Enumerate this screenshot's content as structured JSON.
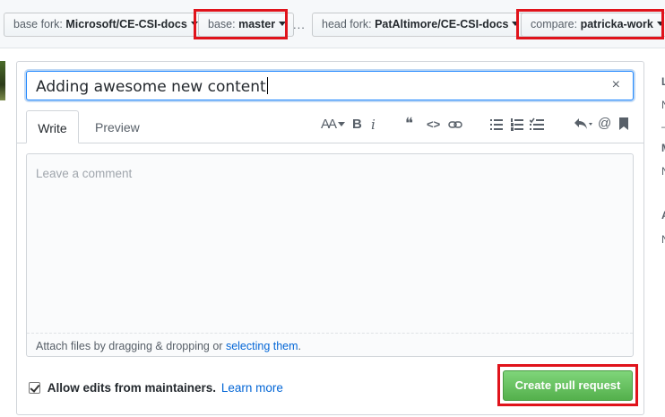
{
  "range_bar": {
    "base_fork": {
      "label": "base fork:",
      "value": "Microsoft/CE-CSI-docs"
    },
    "base": {
      "label": "base:",
      "value": "master"
    },
    "separator": "...",
    "head_fork": {
      "label": "head fork:",
      "value": "PatAltimore/CE-CSI-docs"
    },
    "compare": {
      "label": "compare:",
      "value": "patricka-work"
    }
  },
  "title": {
    "value": "Adding awesome new content",
    "clear_glyph": "×"
  },
  "tabs": [
    {
      "label": "Write",
      "active": true
    },
    {
      "label": "Preview",
      "active": false
    }
  ],
  "toolbar": {
    "heading": "AA",
    "bold": "B",
    "italic": "i",
    "quote": "❝",
    "code": "<>",
    "mention": "@"
  },
  "editor": {
    "placeholder": "Leave a comment",
    "attach_prefix": "Attach files by dragging & dropping or ",
    "attach_link": "selecting them",
    "attach_suffix": "."
  },
  "allow_edits": {
    "checked": true,
    "label": "Allow edits from maintainers.",
    "learn_more": "Learn more"
  },
  "create_button": "Create pull request",
  "sidebar_letters": [
    "L",
    "N",
    "–",
    "M",
    "N",
    "A",
    "N"
  ],
  "colors": {
    "highlight": "#e0131b",
    "accent_blue": "#2188ff",
    "create_green": "#5cb85c",
    "link": "#0366d6"
  }
}
